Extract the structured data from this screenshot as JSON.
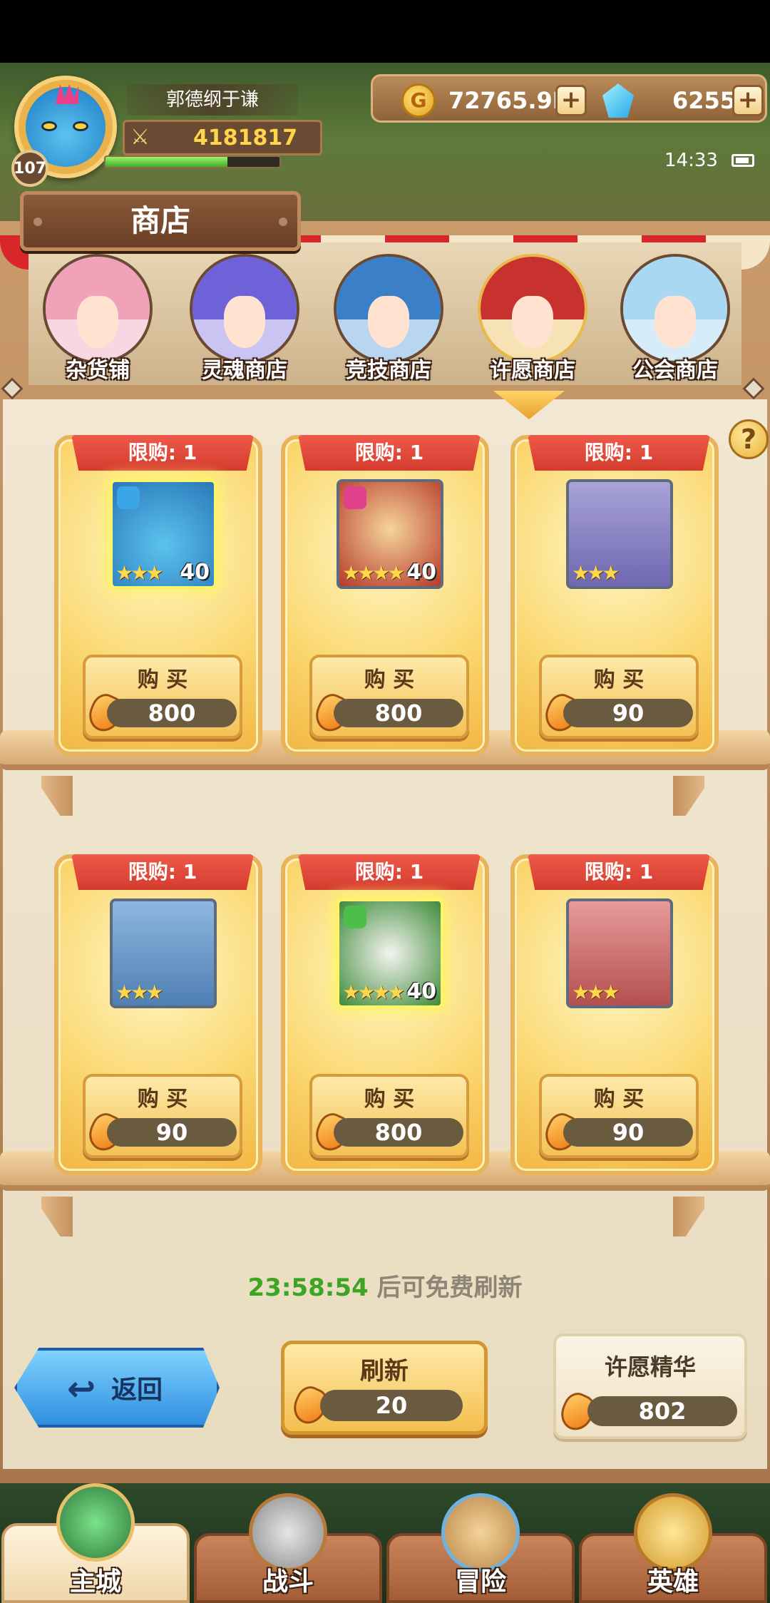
{
  "player": {
    "name": "郭德纲于谦",
    "level": "107",
    "power": "4181817",
    "exp_fraction": 0.7
  },
  "currency": {
    "gold": "72765.9K",
    "gems": "6255",
    "plus": "+"
  },
  "status": {
    "time": "14:33"
  },
  "shop": {
    "title": "商店",
    "help": "?",
    "tabs": [
      {
        "label": "杂货铺"
      },
      {
        "label": "灵魂商店"
      },
      {
        "label": "竞技商店"
      },
      {
        "label": "许愿商店"
      },
      {
        "label": "公会商店"
      }
    ],
    "active_tab": "许愿商店",
    "buy_label": "购 买",
    "items": [
      {
        "limit": "限购: 1",
        "stars": "★★★",
        "level": "40",
        "price": "800"
      },
      {
        "limit": "限购: 1",
        "stars": "★★★★",
        "level": "40",
        "price": "800"
      },
      {
        "limit": "限购: 1",
        "stars": "★★★",
        "level": "",
        "price": "90"
      },
      {
        "limit": "限购: 1",
        "stars": "★★★",
        "level": "",
        "price": "90"
      },
      {
        "limit": "限购: 1",
        "stars": "★★★★",
        "level": "40",
        "price": "800"
      },
      {
        "limit": "限购: 1",
        "stars": "★★★",
        "level": "",
        "price": "90"
      }
    ],
    "timer": {
      "time": "23:58:54",
      "text": " 后可免费刷新"
    },
    "back_label": "返回",
    "refresh": {
      "label": "刷新",
      "price": "20"
    },
    "essence": {
      "label": "许愿精华",
      "value": "802"
    }
  },
  "nav": {
    "tabs": [
      {
        "label": "主城"
      },
      {
        "label": "战斗"
      },
      {
        "label": "冒险"
      },
      {
        "label": "英雄"
      }
    ]
  }
}
